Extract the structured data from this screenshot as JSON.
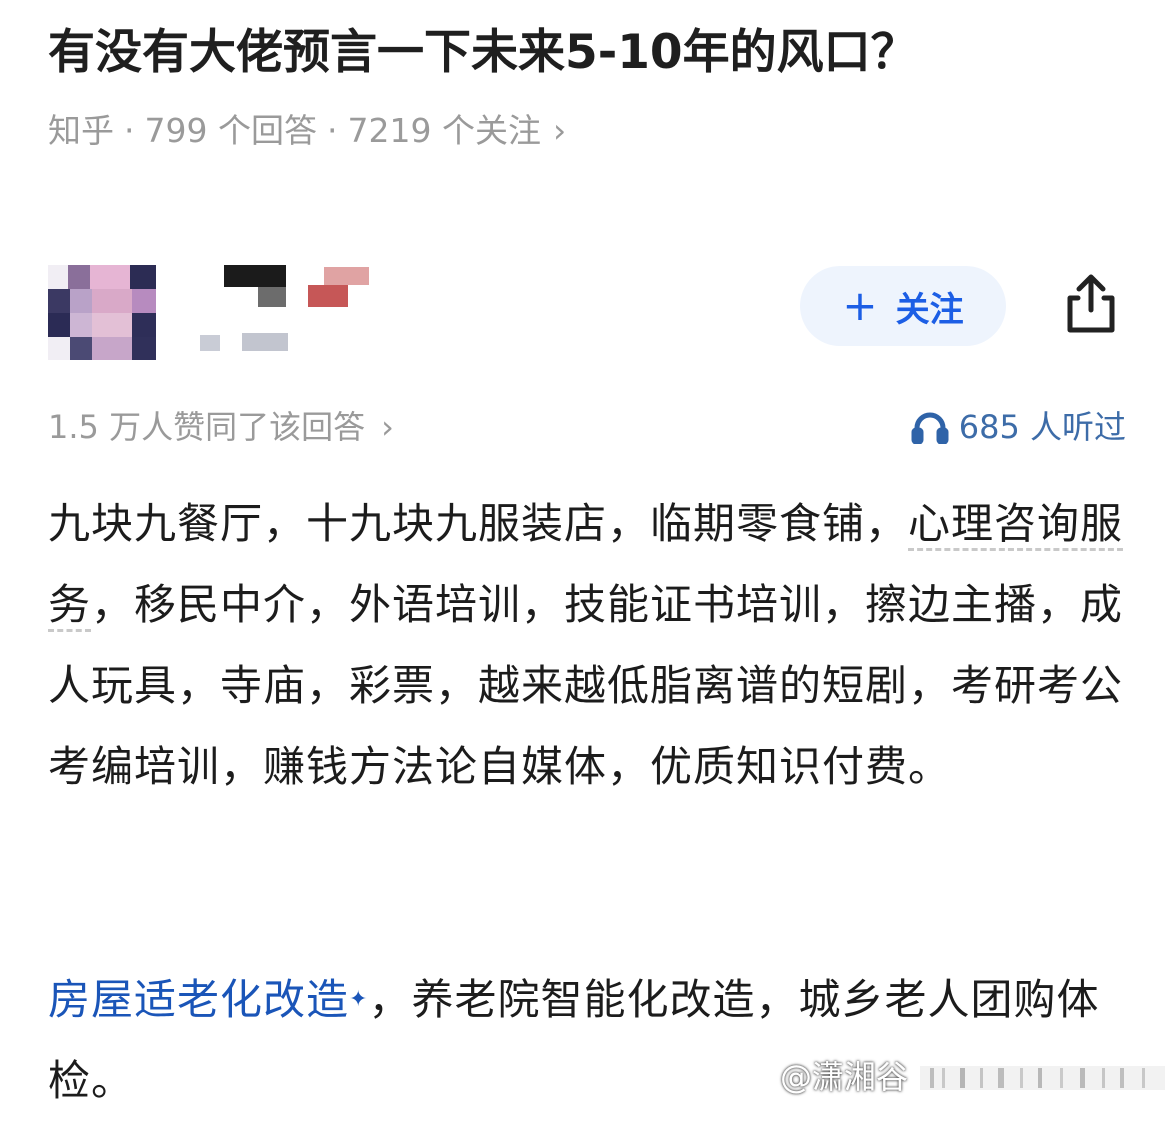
{
  "question": {
    "title": "有没有大佬预言一下未来5-10年的风口？",
    "source": "知乎",
    "answers": "799 个回答",
    "follows": "7219 个关注"
  },
  "author": {
    "follow_label": "关注"
  },
  "answer": {
    "likes": "1.5 万人赞同了该回答",
    "listened": "685 人听过",
    "p1_a": "九块九餐厅，十九块九服装店，临期零食铺，",
    "p1_link": "心理咨询服务",
    "p1_b": "，移民中介，外语培训，技能证书培训，擦边主播，成人玩具，寺庙，彩票，越来越低脂离谱的短剧，考研考公考编培训，赚钱方法论自媒体，优质知识付费。",
    "p2_link": "房屋适老化改造",
    "p2_b": "，养老院智能化改造，城乡老人团购体检。"
  },
  "watermark": "@潇湘谷",
  "colors": {
    "accent": "#1c5ee5",
    "follow_bg": "#eef4fd",
    "muted": "#9a9a9a",
    "link": "#1a55b8"
  },
  "icons": [
    "plus-icon",
    "share-icon",
    "headphone-icon",
    "chevron-right-icon"
  ]
}
